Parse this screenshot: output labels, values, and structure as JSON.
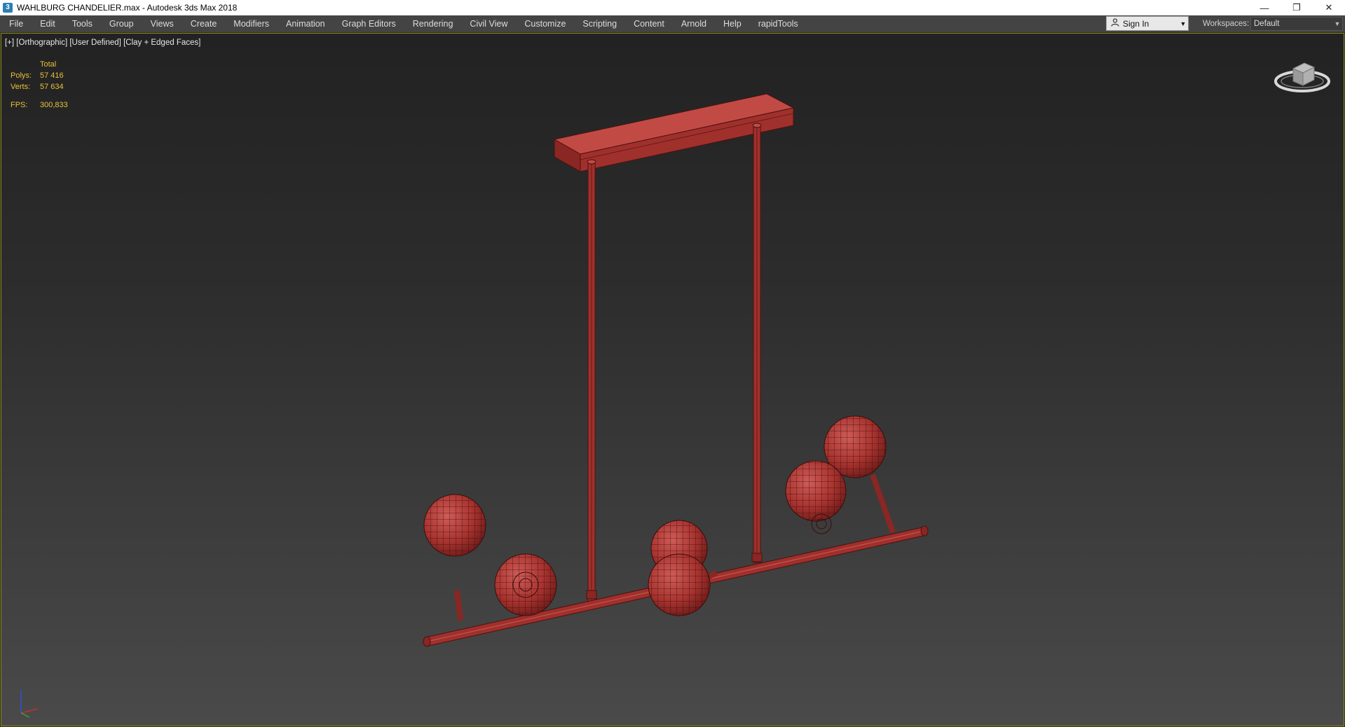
{
  "window": {
    "title": "WAHLBURG CHANDELIER.max - Autodesk 3ds Max 2018",
    "app_icon_glyph": "3",
    "buttons": {
      "minimize": "—",
      "restore": "❐",
      "close": "✕"
    }
  },
  "menu": {
    "items": [
      "File",
      "Edit",
      "Tools",
      "Group",
      "Views",
      "Create",
      "Modifiers",
      "Animation",
      "Graph Editors",
      "Rendering",
      "Civil View",
      "Customize",
      "Scripting",
      "Content",
      "Arnold",
      "Help",
      "rapidTools"
    ],
    "sign_in": {
      "icon": "user-icon",
      "label": "Sign In"
    },
    "workspaces": {
      "label": "Workspaces:",
      "value": "Default"
    }
  },
  "viewport": {
    "label": "[+] [Orthographic] [User Defined] [Clay + Edged Faces]",
    "stats": {
      "header": "Total",
      "polys_label": "Polys:",
      "polys_value": "57 416",
      "verts_label": "Verts:",
      "verts_value": "57 634",
      "fps_label": "FPS:",
      "fps_value": "300,833"
    },
    "model_color": "#a8332f",
    "gizmo_axes": {
      "x": "#c93030",
      "y": "#2fa82f",
      "z": "#3050d0"
    }
  }
}
